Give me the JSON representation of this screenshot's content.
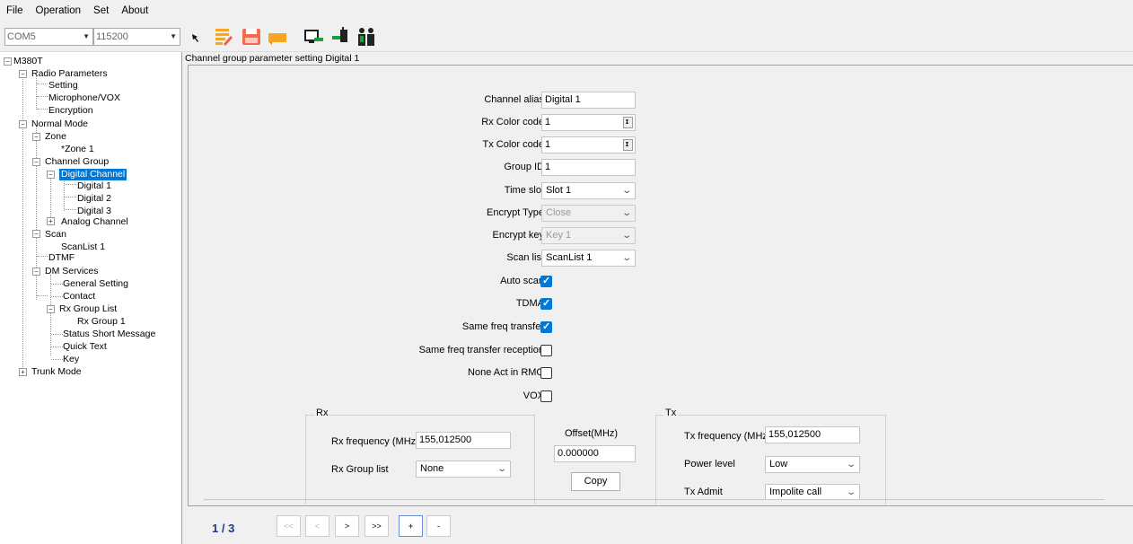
{
  "menu": [
    "File",
    "Operation",
    "Set",
    "About"
  ],
  "toolbar": {
    "port": "COM5",
    "baud": "115200",
    "icons": [
      "cursor-icon",
      "read-icon",
      "save-icon",
      "folder-icon",
      "write-radio-icon",
      "plug-icon",
      "users-icon"
    ]
  },
  "tree": [
    {
      "label": "M380T"
    },
    {
      "label": "Radio Parameters"
    },
    {
      "label": "Setting"
    },
    {
      "label": "Microphone/VOX"
    },
    {
      "label": "Encryption"
    },
    {
      "label": "Normal Mode"
    },
    {
      "label": "Zone"
    },
    {
      "label": "*Zone 1"
    },
    {
      "label": "Channel Group"
    },
    {
      "label": "Digital Channel"
    },
    {
      "label": "Digital 1"
    },
    {
      "label": "Digital 2"
    },
    {
      "label": "Digital 3"
    },
    {
      "label": "Analog Channel"
    },
    {
      "label": "Scan"
    },
    {
      "label": "ScanList 1"
    },
    {
      "label": "DTMF"
    },
    {
      "label": "DM Services"
    },
    {
      "label": "General Setting"
    },
    {
      "label": "Contact"
    },
    {
      "label": "Rx Group List"
    },
    {
      "label": "Rx Group 1"
    },
    {
      "label": "Status Short Message"
    },
    {
      "label": "Quick Text"
    },
    {
      "label": "Key"
    },
    {
      "label": "Trunk Mode"
    }
  ],
  "panel_title": "Channel group parameter setting Digital 1",
  "form": {
    "channel_alias": {
      "label": "Channel alias",
      "value": "Digital 1"
    },
    "rx_color_code": {
      "label": "Rx Color code",
      "value": "1"
    },
    "tx_color_code": {
      "label": "Tx Color code",
      "value": "1"
    },
    "group_id": {
      "label": "Group ID",
      "value": "1"
    },
    "time_slot": {
      "label": "Time slot",
      "value": "Slot 1"
    },
    "encrypt_type": {
      "label": "Encrypt Type",
      "value": "Close"
    },
    "encrypt_key": {
      "label": "Encrypt key",
      "value": "Key 1"
    },
    "scan_list": {
      "label": "Scan list",
      "value": "ScanList 1"
    },
    "auto_scan": {
      "label": "Auto scan",
      "checked": true
    },
    "tdma": {
      "label": "TDMA",
      "checked": true
    },
    "same_freq_transfer": {
      "label": "Same freq transfer",
      "checked": true
    },
    "same_freq_transfer_reception": {
      "label": "Same freq transfer reception",
      "checked": false
    },
    "none_act_in_rmo": {
      "label": "None Act in RMO",
      "checked": false
    },
    "vox": {
      "label": "VOX",
      "checked": false
    }
  },
  "rx": {
    "title": "Rx",
    "freq_label": "Rx frequency (MHz)",
    "freq_value": "155,012500",
    "group_label": "Rx Group list",
    "group_value": "None"
  },
  "offset": {
    "label": "Offset(MHz)",
    "value": "0.000000",
    "copy_label": "Copy"
  },
  "tx": {
    "title": "Tx",
    "freq_label": "Tx frequency (MHz)",
    "freq_value": "155,012500",
    "power_label": "Power level",
    "power_value": "Low",
    "admit_label": "Tx Admit",
    "admit_value": "Impolite call"
  },
  "pager": {
    "page": "1 / 3",
    "first": "<<",
    "prev": "<",
    "next": ">",
    "last": ">>",
    "add": "+",
    "remove": "-"
  },
  "colors": {
    "selection": "#0078d7",
    "check": "#0078d7",
    "pager_text": "#1a3a8f"
  }
}
